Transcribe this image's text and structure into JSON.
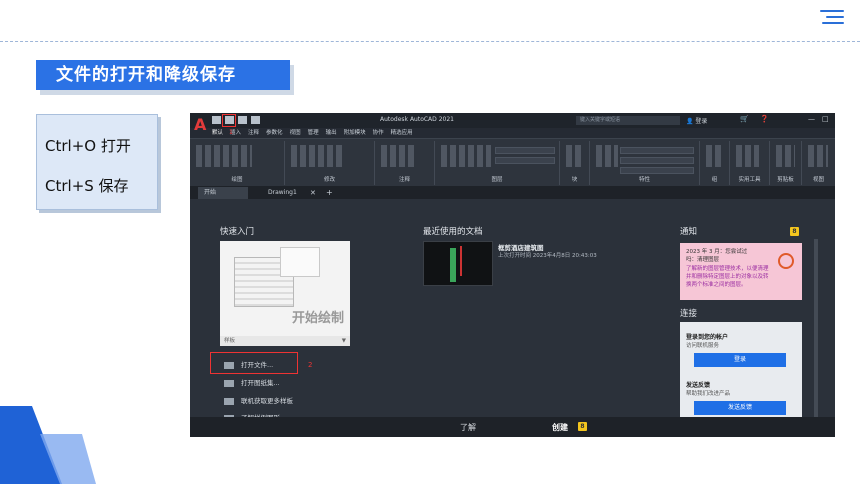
{
  "slide": {
    "title": "文件的打开和降级保存",
    "shortcuts": [
      "Ctrl+O 打开",
      "Ctrl+S 保存"
    ]
  },
  "app": {
    "window_title": "Autodesk AutoCAD 2021",
    "search_placeholder": "键入关键字或短语",
    "login_label": "登录",
    "menu_tabs": [
      "默认",
      "插入",
      "注释",
      "参数化",
      "视图",
      "管理",
      "输出",
      "附加模块",
      "协作",
      "精选应用"
    ],
    "ribbon_groups": [
      "绘图",
      "修改",
      "注释",
      "图层",
      "块",
      "特性",
      "组",
      "实用工具",
      "剪贴板",
      "视图"
    ],
    "file_tabs": [
      "开始",
      "Drawing1"
    ],
    "quick_start": {
      "heading": "快速入门",
      "template_caption": "开始绘制",
      "template_label": "样板",
      "items": [
        "打开文件...",
        "打开图纸集...",
        "联机获取更多样板",
        "了解样例图形"
      ]
    },
    "recent": {
      "heading": "最近使用的文档",
      "doc_name": "框剪酒店建筑图",
      "doc_date": "上次打开时间 2023年4月8日 20:43:03"
    },
    "notifications": {
      "heading": "通知",
      "count": "8",
      "line1": "2023 年 3 月：您尝试过",
      "line2": "吗：清理图层",
      "body": "了解新的图层管理技术，以便清理并和删除特定图层上的对象以及转换两个标准之间的图层。"
    },
    "connect": {
      "heading": "连接",
      "signin_title": "登录到您的帐户",
      "signin_sub": "访问联机服务",
      "signin_button": "登录",
      "feedback_title": "发送反馈",
      "feedback_sub": "帮助我们改进产品",
      "feedback_button": "发送反馈"
    },
    "bottom_tabs": {
      "learn": "了解",
      "create": "创建",
      "create_badge": "8"
    },
    "annotation_1": "1",
    "annotation_2": "2"
  },
  "colors": {
    "accent": "#2b72e5",
    "cad_bg": "#2b313a",
    "highlight": "#e33333",
    "badge": "#f3c51e"
  }
}
